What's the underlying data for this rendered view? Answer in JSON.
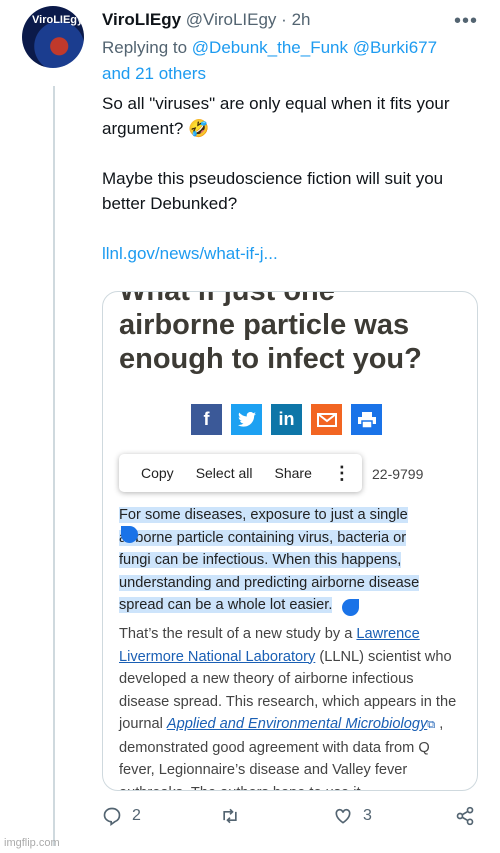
{
  "author": {
    "name": "ViroLIEgy",
    "handle": "@ViroLIEgy",
    "sep": "·",
    "time": "2h",
    "avatar_text": "ViroLIEgy"
  },
  "reply": {
    "prefix": "Replying to",
    "users": "@Debunk_the_Funk @Burki677",
    "others": "and 21 others"
  },
  "tweet": {
    "line1": "So all \"viruses\" are only equal when it fits your argument? 🤣",
    "line2": "Maybe this pseudoscience fiction will suit you better Debunked?",
    "link": "llnl.gov/news/what-if-j..."
  },
  "media": {
    "headline_partial": "What if just one",
    "headline": "airborne particle was enough to infect you?",
    "share_icons": [
      "facebook-icon",
      "twitter-icon",
      "linkedin-icon",
      "email-icon",
      "print-icon"
    ],
    "menu": {
      "copy": "Copy",
      "select_all": "Select all",
      "share": "Share",
      "more": "⋮"
    },
    "phone_partial": "22-9799",
    "selected_text": "For some diseases, exposure to just a single airborne particle containing virus, bacteria or fungi can be infectious. When this happens, understanding and predicting airborne disease spread can be a whole lot easier.",
    "body": {
      "t1": "That’s the result of a new study by a ",
      "link1": "Lawrence Livermore National Laboratory",
      "t2": " (LLNL) scientist who developed a new theory of airborne infectious disease spread. This research, which appears in the journal ",
      "link2": "Applied and Environmental Microbiology",
      "t3": " , demonstrated good agreement with data from Q fever, Legionnaire’s disease and Valley fever outbreaks. The authors hope to use it"
    }
  },
  "actions": {
    "replies": "2",
    "likes": "3"
  },
  "colors": {
    "accent": "#1d9bf0",
    "muted": "#536471",
    "selection": "#cde4fb",
    "handle": "#1a73e8"
  },
  "watermark": "imgflip.com"
}
